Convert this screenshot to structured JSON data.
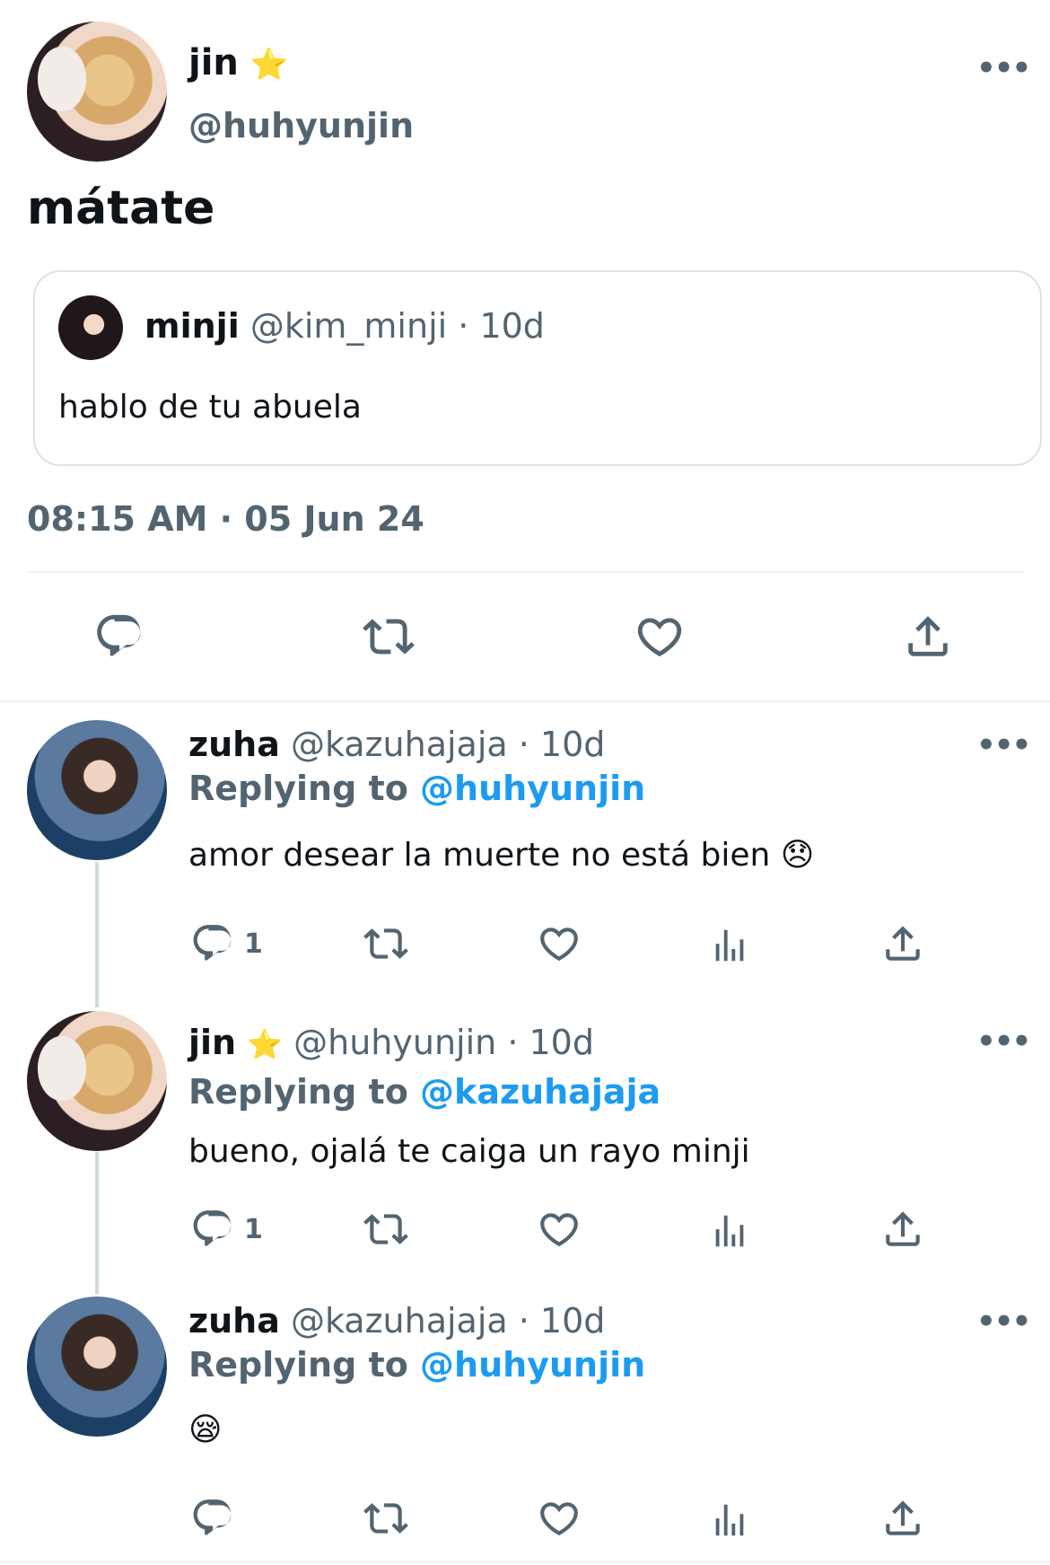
{
  "main_tweet": {
    "name": "jin",
    "name_badge": "⭐",
    "handle": "@huhyunjin",
    "more": "•••",
    "text": "mátate",
    "quote": {
      "name": "minji",
      "handle": "@kim_minji",
      "time": "· 10d",
      "text": "hablo de tu abuela"
    },
    "timestamp": "08:15 AM · 05 Jun 24"
  },
  "replies": [
    {
      "name": "zuha",
      "handle": "@kazuhajaja · 10d",
      "replying_prefix": "Replying to",
      "replying_to": "@huhyunjin",
      "text": "amor desear la muerte no está bien",
      "emoji": "😞",
      "reply_count": "1",
      "more": "•••"
    },
    {
      "name": "jin",
      "name_badge": "⭐",
      "handle": "@huhyunjin · 10d",
      "replying_prefix": "Replying to",
      "replying_to": "@kazuhajaja",
      "text": "bueno, ojalá te caiga un rayo minji",
      "reply_count": "1",
      "more": "•••"
    },
    {
      "name": "zuha",
      "handle": "@kazuhajaja · 10d",
      "replying_prefix": "Replying to",
      "replying_to": "@huhyunjin",
      "emoji": "😪",
      "more": "•••"
    }
  ],
  "icons": {
    "reply": "reply-icon",
    "retweet": "retweet-icon",
    "like": "heart-icon",
    "views": "views-icon",
    "share": "share-icon",
    "more": "more-icon"
  },
  "colors": {
    "link_blue": "#1d9bf0",
    "secondary": "#536471",
    "divider": "#eff3f4"
  }
}
